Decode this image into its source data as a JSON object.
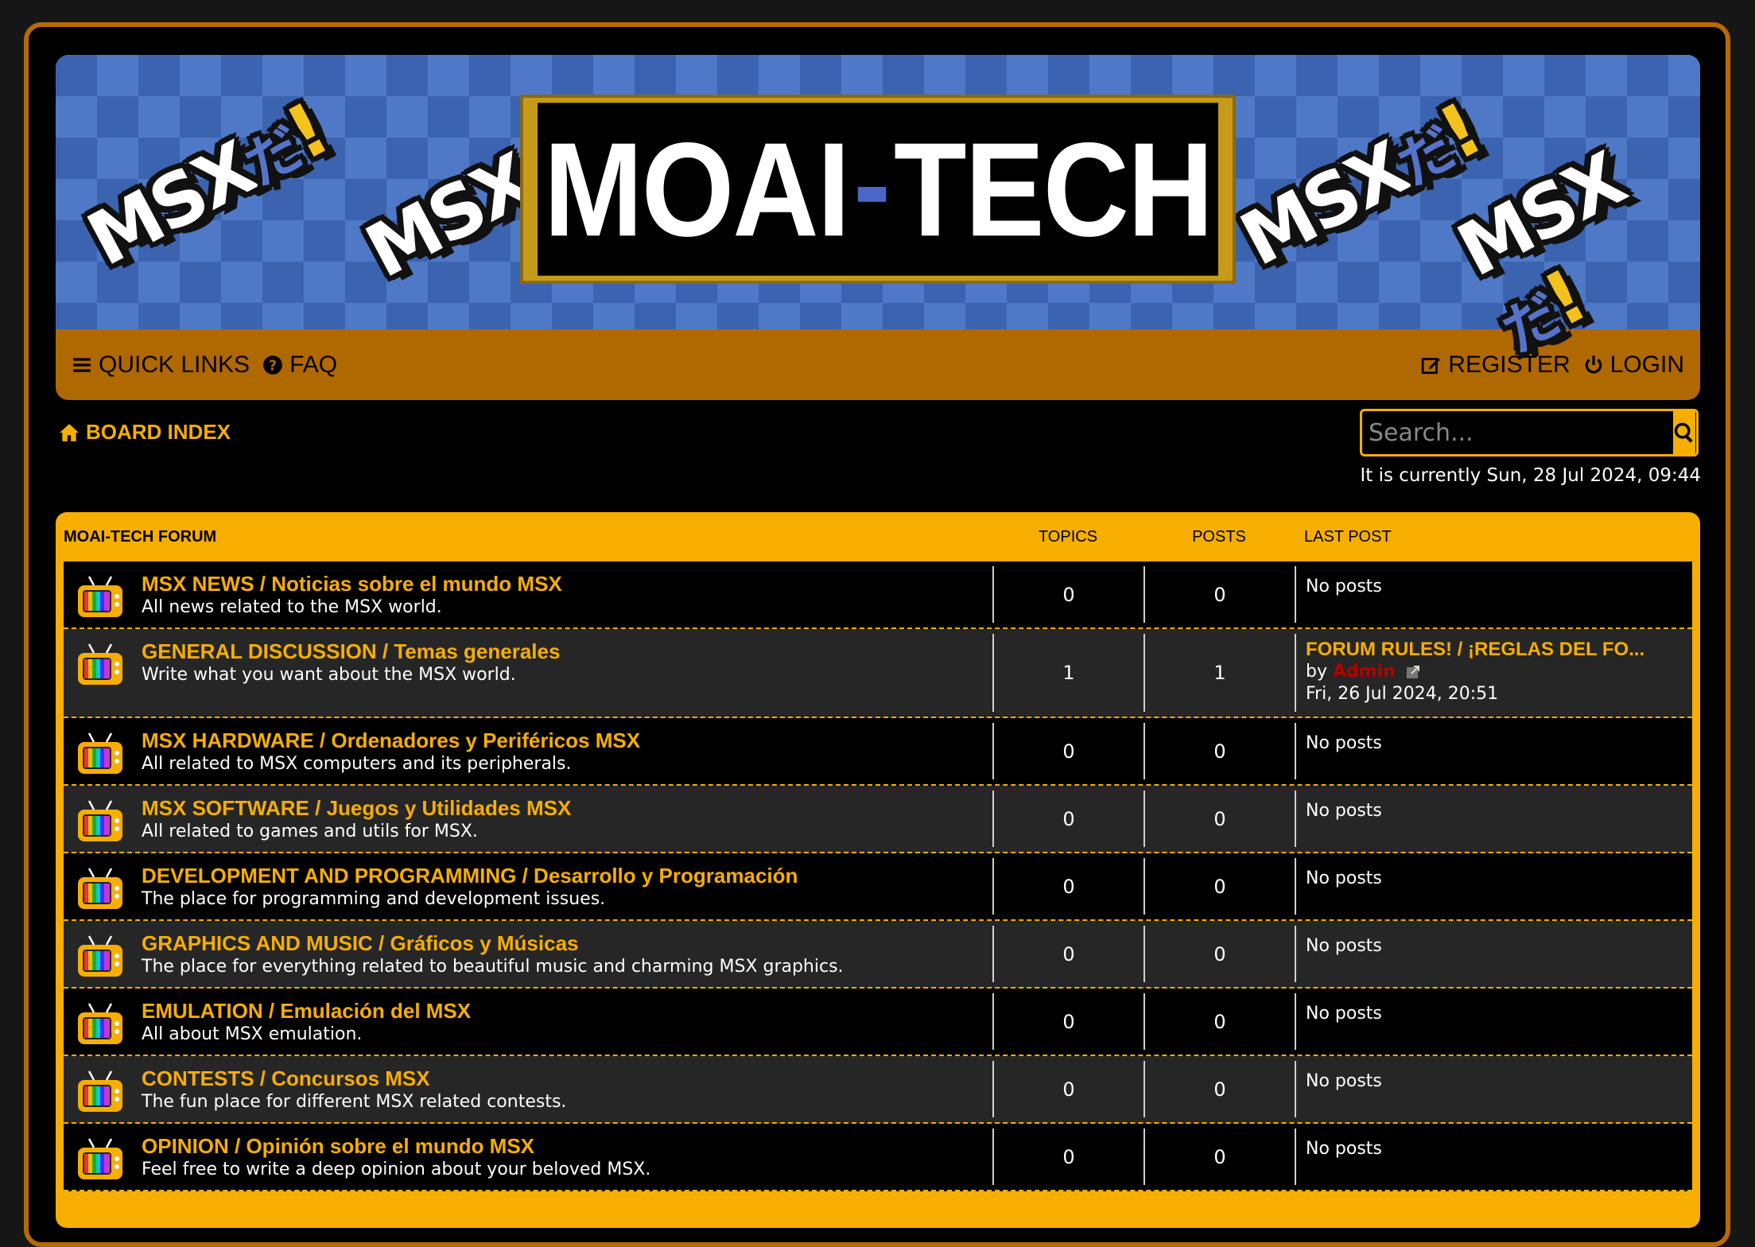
{
  "site": {
    "title_left": "MOAI",
    "title_sep": "-",
    "title_right": "TECH",
    "banner_logo": {
      "msx": "MSX",
      "da": "だ",
      "bang": "!"
    }
  },
  "nav": {
    "quick_links": "QUICK LINKS",
    "faq": "FAQ",
    "register": "REGISTER",
    "login": "LOGIN"
  },
  "breadcrumb": {
    "board_index": "BOARD INDEX"
  },
  "search": {
    "placeholder": "Search..."
  },
  "current_time": "It is currently Sun, 28 Jul 2024, 09:44",
  "table": {
    "headers": {
      "forum": "MOAI-TECH FORUM",
      "topics": "TOPICS",
      "posts": "POSTS",
      "last_post": "LAST POST"
    },
    "rows": [
      {
        "name": "MSX NEWS / Noticias sobre el mundo MSX",
        "desc": "All news related to the MSX world.",
        "topics": "0",
        "posts": "0",
        "last": "No posts"
      },
      {
        "name": "GENERAL DISCUSSION / Temas generales",
        "desc": "Write what you want about the MSX world.",
        "topics": "1",
        "posts": "1",
        "last_title": "FORUM RULES! / ¡REGLAS DEL FO...",
        "last_by": "by",
        "last_author": "Admin",
        "last_date": "Fri, 26 Jul 2024, 20:51"
      },
      {
        "name": "MSX HARDWARE / Ordenadores y Periféricos MSX",
        "desc": "All related to MSX computers and its peripherals.",
        "topics": "0",
        "posts": "0",
        "last": "No posts"
      },
      {
        "name": "MSX SOFTWARE / Juegos y Utilidades MSX",
        "desc": "All related to games and utils for MSX.",
        "topics": "0",
        "posts": "0",
        "last": "No posts"
      },
      {
        "name": "DEVELOPMENT AND PROGRAMMING / Desarrollo y Programación",
        "desc": "The place for programming and development issues.",
        "topics": "0",
        "posts": "0",
        "last": "No posts"
      },
      {
        "name": "GRAPHICS AND MUSIC / Gráficos y Músicas",
        "desc": "The place for everything related to beautiful music and charming MSX graphics.",
        "topics": "0",
        "posts": "0",
        "last": "No posts"
      },
      {
        "name": "EMULATION / Emulación del MSX",
        "desc": "All about MSX emulation.",
        "topics": "0",
        "posts": "0",
        "last": "No posts"
      },
      {
        "name": "CONTESTS / Concursos MSX",
        "desc": "The fun place for different MSX related contests.",
        "topics": "0",
        "posts": "0",
        "last": "No posts"
      },
      {
        "name": "OPINION / Opinión sobre el mundo MSX",
        "desc": "Feel free to write a deep opinion about your beloved MSX.",
        "topics": "0",
        "posts": "0",
        "last": "No posts"
      }
    ]
  },
  "colors": {
    "accent": "#f7ae00",
    "navbar": "#b06800",
    "frame": "#b86a00",
    "author": "#b20000"
  }
}
